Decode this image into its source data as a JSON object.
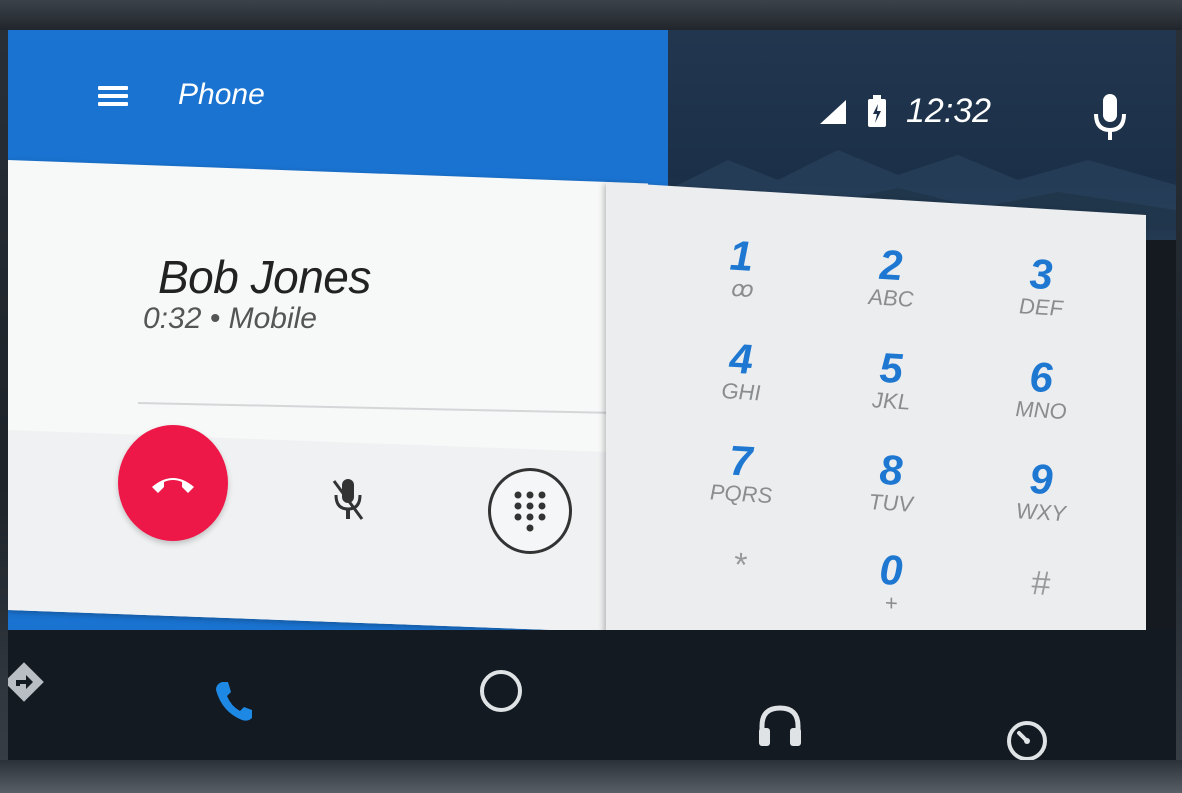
{
  "header": {
    "title": "Phone",
    "time": "12:32"
  },
  "call": {
    "contact_name": "Bob Jones",
    "duration": "0:32",
    "separator": " • ",
    "phone_type": "Mobile"
  },
  "dialpad": {
    "keys": [
      {
        "digit": "1",
        "letters": "ꝏ"
      },
      {
        "digit": "2",
        "letters": "ABC"
      },
      {
        "digit": "3",
        "letters": "DEF"
      },
      {
        "digit": "4",
        "letters": "GHI"
      },
      {
        "digit": "5",
        "letters": "JKL"
      },
      {
        "digit": "6",
        "letters": "MNO"
      },
      {
        "digit": "7",
        "letters": "PQRS"
      },
      {
        "digit": "8",
        "letters": "TUV"
      },
      {
        "digit": "9",
        "letters": "WXY"
      },
      {
        "digit": "*",
        "letters": ""
      },
      {
        "digit": "0",
        "letters": "+"
      },
      {
        "digit": "#",
        "letters": ""
      }
    ]
  },
  "nav": {
    "items": [
      "navigation-icon",
      "phone-icon",
      "home-icon",
      "headphones-icon",
      "recents-icon"
    ],
    "active": "phone-icon"
  },
  "colors": {
    "accent_blue": "#1a73d0",
    "end_call_red": "#ee1848",
    "digit_blue": "#1e78d2"
  }
}
